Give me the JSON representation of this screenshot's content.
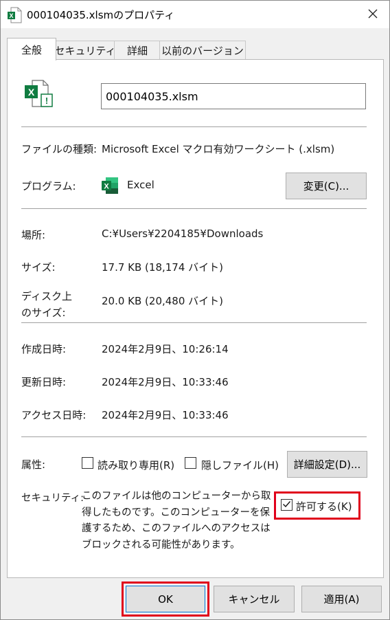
{
  "window": {
    "title": "000104035.xlsmのプロパティ",
    "close_icon": "close-icon"
  },
  "tabs": [
    {
      "label": "全般",
      "active": true
    },
    {
      "label": "セキュリティ",
      "active": false
    },
    {
      "label": "詳細",
      "active": false
    },
    {
      "label": "以前のバージョン",
      "active": false
    }
  ],
  "general": {
    "file_icon": "excel-file-warning-icon",
    "filename": "000104035.xlsm",
    "type_label": "ファイルの種類:",
    "type_value": "Microsoft Excel マクロ有効ワークシート (.xlsm)",
    "program_label": "プログラム:",
    "program_icon": "excel-icon",
    "program_value": "Excel",
    "change_button": "変更(C)...",
    "location_label": "場所:",
    "location_value": "C:¥Users¥2204185¥Downloads",
    "size_label": "サイズ:",
    "size_value": "17.7 KB (18,174 バイト)",
    "disk_size_label_1": "ディスク上",
    "disk_size_label_2": "のサイズ:",
    "disk_size_value": "20.0 KB (20,480 バイト)",
    "created_label": "作成日時:",
    "created_value": "2024年2月9日、10:26:14",
    "modified_label": "更新日時:",
    "modified_value": "2024年2月9日、10:33:46",
    "accessed_label": "アクセス日時:",
    "accessed_value": "2024年2月9日、10:33:46",
    "attributes_label": "属性:",
    "readonly_label": "読み取り専用(R)",
    "readonly_checked": false,
    "hidden_label": "隠しファイル(H)",
    "hidden_checked": false,
    "advanced_button": "詳細設定(D)...",
    "security_label": "セキュリティ:",
    "security_text": "このファイルは他のコンピューターから取得したものです。このコンピューターを保護するため、このファイルへのアクセスはブロックされる可能性があります。",
    "unblock_label": "許可する(K)",
    "unblock_checked": true
  },
  "buttons": {
    "ok": "OK",
    "cancel": "キャンセル",
    "apply": "適用(A)"
  },
  "colors": {
    "highlight": "#e0001b",
    "excel_green": "#107c41"
  }
}
